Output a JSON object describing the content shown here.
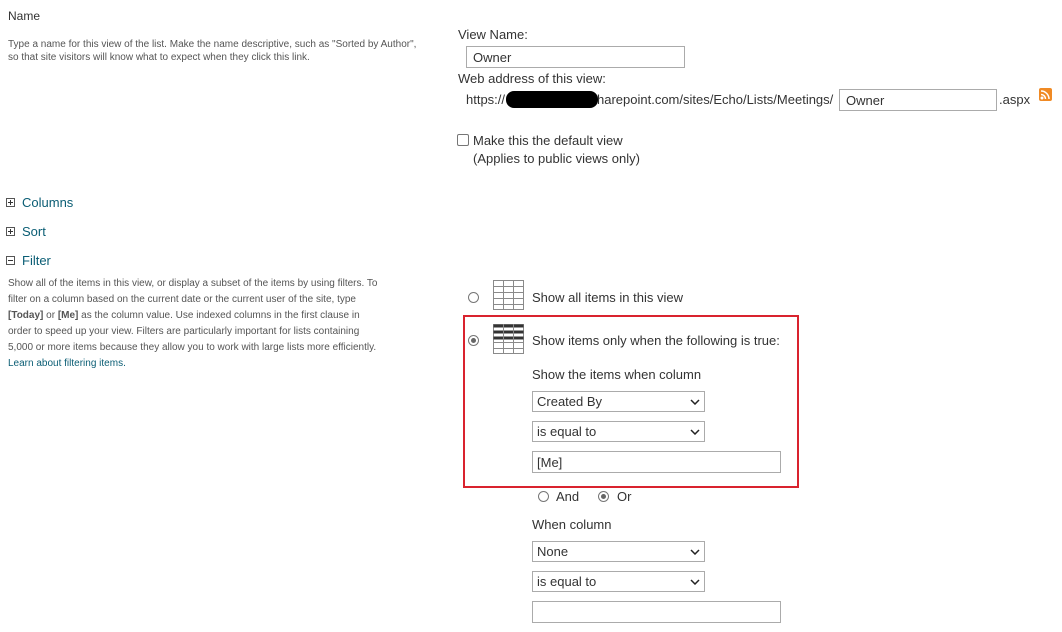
{
  "name_section": {
    "title": "Name",
    "description_line1": "Type a name for this view of the list. Make the name descriptive, such as \"Sorted by Author\",",
    "description_line2": "so that site visitors will know what to expect when they click this link."
  },
  "view_name": {
    "label": "View Name:",
    "value": "Owner"
  },
  "web_address": {
    "label": "Web address of this view:",
    "prefix": "https://",
    "domain_suffix": "harepoint.com/sites/Echo/Lists/Meetings/",
    "page_value": "Owner",
    "extension": ".aspx"
  },
  "default_view": {
    "label": "Make this the default view",
    "note": "(Applies to public views only)",
    "checked": false
  },
  "sections": {
    "columns": "Columns",
    "sort": "Sort",
    "filter": "Filter"
  },
  "filter_section": {
    "desc_line1": "Show all of the items in this view, or display a subset of the items by using filters. To",
    "desc_line2": "filter on a column based on the current date or the current user of the site, type",
    "desc_line3_today": "[Today]",
    "desc_line3_or": " or ",
    "desc_line3_me": "[Me]",
    "desc_line3_rest": " as the column value. Use indexed columns in the first clause in",
    "desc_line4": "order to speed up your view. Filters are particularly important for lists containing",
    "desc_line5": "5,000 or more items because they allow you to work with large lists more efficiently.",
    "learn_link": "Learn about filtering items."
  },
  "filter_options": {
    "show_all": "Show all items in this view",
    "show_only": "Show items only when the following is true:",
    "selected": "show_only"
  },
  "clause1": {
    "heading": "Show the items when column",
    "column": "Created By",
    "operator": "is equal to",
    "value": "[Me]"
  },
  "connector": {
    "and_label": "And",
    "or_label": "Or",
    "selected": "Or"
  },
  "clause2": {
    "heading": "When column",
    "column": "None",
    "operator": "is equal to",
    "value": ""
  },
  "colors": {
    "highlight_border": "#d9232e",
    "link": "#0a5d74",
    "rss": "#f08a24"
  }
}
